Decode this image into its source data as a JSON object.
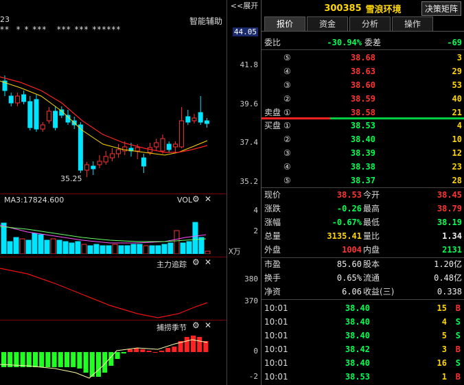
{
  "chart": {
    "expand_label": "<<展开",
    "corner_date": "23",
    "star_marks": "**  * * ***   *** *** ******",
    "aux_label": "智能辅助",
    "min_price_label": "35.25",
    "axis_prices": [
      "44.05",
      "41.8",
      "39.6",
      "37.4",
      "35.2"
    ],
    "vol_ma": "MA3:17824.600",
    "vol_title": "VOL",
    "vol_axis": [
      "4",
      "2",
      "X万"
    ],
    "main_title": "主力追踪",
    "main_axis": [
      "380",
      "370"
    ],
    "season_title": "捕捞季节",
    "season_axis": [
      "0",
      "-2"
    ]
  },
  "colors": {
    "up": "#ff3333",
    "down": "#00e5ff",
    "bg": "#000000",
    "accent": "#ffd700"
  },
  "quote": {
    "code": "300385",
    "name": "雪浪环境",
    "decision_button": "决策矩阵",
    "tabs": [
      "报价",
      "资金",
      "分析",
      "操作"
    ],
    "weibi_label": "委比",
    "weibi_value": "-30.94%",
    "weicha_label": "委差",
    "weicha_value": "-69",
    "sell_label": "卖盘",
    "buy_label": "买盘",
    "asks": [
      {
        "level": "⑤",
        "price": "38.68",
        "vol": "3"
      },
      {
        "level": "④",
        "price": "38.63",
        "vol": "29"
      },
      {
        "level": "③",
        "price": "38.60",
        "vol": "53"
      },
      {
        "level": "②",
        "price": "38.59",
        "vol": "40"
      },
      {
        "level": "①",
        "price": "38.58",
        "vol": "21"
      }
    ],
    "bids": [
      {
        "level": "①",
        "price": "38.53",
        "vol": "4"
      },
      {
        "level": "②",
        "price": "38.40",
        "vol": "10"
      },
      {
        "level": "③",
        "price": "38.39",
        "vol": "12"
      },
      {
        "level": "④",
        "price": "38.38",
        "vol": "23"
      },
      {
        "level": "⑤",
        "price": "38.37",
        "vol": "28"
      }
    ],
    "stats": [
      {
        "l1": "现价",
        "v1": "38.53",
        "c1": "red",
        "l2": "今开",
        "v2": "38.45",
        "c2": "red"
      },
      {
        "l1": "涨跌",
        "v1": "-0.26",
        "c1": "grn",
        "l2": "最高",
        "v2": "38.79",
        "c2": "red"
      },
      {
        "l1": "涨幅",
        "v1": "-0.67%",
        "c1": "grn",
        "l2": "最低",
        "v2": "38.19",
        "c2": "grn"
      },
      {
        "l1": "总量",
        "v1": "3135.41",
        "c1": "yel",
        "l2": "量比",
        "v2": "1.34",
        "c2": "wht"
      },
      {
        "l1": "外盘",
        "v1": "1004",
        "c1": "red",
        "l2": "内盘",
        "v2": "2131",
        "c2": "grn"
      }
    ],
    "stats2": [
      {
        "l1": "市盈",
        "v1": "85.60",
        "l2": "股本",
        "v2": "1.20亿"
      },
      {
        "l1": "换手",
        "v1": "0.65%",
        "l2": "流通",
        "v2": "0.48亿"
      },
      {
        "l1": "净资",
        "v1": "6.06",
        "l2": "收益(三)",
        "v2": "0.338"
      }
    ],
    "ticks": [
      {
        "time": "10:01",
        "price": "38.40",
        "vol": "15",
        "side": "B"
      },
      {
        "time": "10:01",
        "price": "38.40",
        "vol": "4",
        "side": "S"
      },
      {
        "time": "10:01",
        "price": "38.40",
        "vol": "5",
        "side": "S"
      },
      {
        "time": "10:01",
        "price": "38.42",
        "vol": "3",
        "side": "B"
      },
      {
        "time": "10:01",
        "price": "38.40",
        "vol": "16",
        "side": "S"
      },
      {
        "time": "10:01",
        "price": "38.53",
        "vol": "1",
        "side": "B"
      }
    ]
  }
}
